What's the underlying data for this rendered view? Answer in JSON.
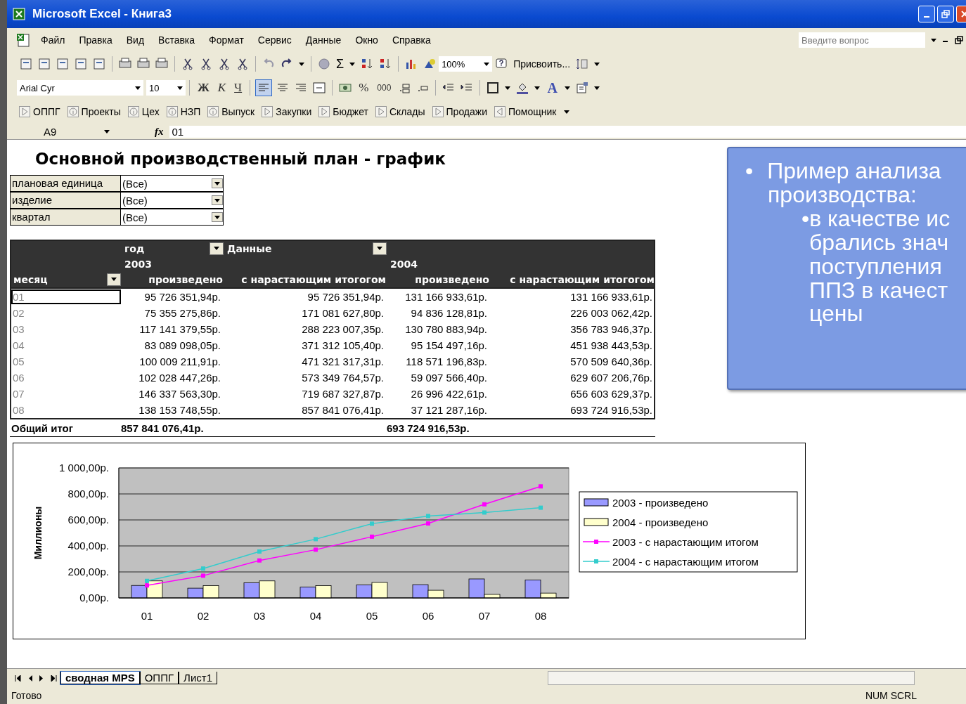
{
  "window": {
    "title": "Microsoft Excel - Книга3"
  },
  "menu": [
    "Файл",
    "Правка",
    "Вид",
    "Вставка",
    "Формат",
    "Сервис",
    "Данные",
    "Окно",
    "Справка"
  ],
  "help_search": {
    "placeholder": "Введите вопрос"
  },
  "standard_toolbar": {
    "sum": "Σ",
    "zoom": "100%",
    "assign": "Присвоить..."
  },
  "formatting_toolbar": {
    "font": "Arial Cyr",
    "size": "10",
    "bold": "Ж",
    "italic": "К",
    "underline": "Ч",
    "percent": "%",
    "thousands": "000",
    "font_color": "A"
  },
  "custom_toolbar": [
    {
      "label": "ОППГ",
      "kind": "play"
    },
    {
      "label": "Проекты",
      "kind": "info"
    },
    {
      "label": "Цех",
      "kind": "info"
    },
    {
      "label": "НЗП",
      "kind": "info"
    },
    {
      "label": "Выпуск",
      "kind": "info"
    },
    {
      "label": "Закупки",
      "kind": "play"
    },
    {
      "label": "Бюджет",
      "kind": "play"
    },
    {
      "label": "Склады",
      "kind": "play"
    },
    {
      "label": "Продажи",
      "kind": "play"
    },
    {
      "label": "Помощник",
      "kind": "back"
    }
  ],
  "formula_bar": {
    "cell": "A9",
    "fx": "fx",
    "value": "01"
  },
  "sheet": {
    "title": "Основной производственный план - график",
    "filters": [
      {
        "label": "плановая единица",
        "value": "(Все)"
      },
      {
        "label": "изделие",
        "value": "(Все)"
      },
      {
        "label": "квартал",
        "value": "(Все)"
      }
    ],
    "pivot": {
      "year_field": "год",
      "data_field": "Данные",
      "years": [
        "2003",
        "2004"
      ],
      "row_field": "месяц",
      "columns": [
        "произведено",
        "с нарастающим итогогом",
        "произведено",
        "с нарастающим итогогом"
      ],
      "rows": [
        {
          "month": "01",
          "selected": true,
          "cells": [
            "95 726 351,94р.",
            "95 726 351,94р.",
            "131 166 933,61р.",
            "131 166 933,61р."
          ]
        },
        {
          "month": "02",
          "selected": false,
          "cells": [
            "75 355 275,86р.",
            "171 081 627,80р.",
            "94 836 128,81р.",
            "226 003 062,42р."
          ]
        },
        {
          "month": "03",
          "selected": false,
          "cells": [
            "117 141 379,55р.",
            "288 223 007,35р.",
            "130 780 883,94р.",
            "356 783 946,37р."
          ]
        },
        {
          "month": "04",
          "selected": false,
          "cells": [
            "83 089 098,05р.",
            "371 312 105,40р.",
            "95 154 497,16р.",
            "451 938 443,53р."
          ]
        },
        {
          "month": "05",
          "selected": false,
          "cells": [
            "100 009 211,91р.",
            "471 321 317,31р.",
            "118 571 196,83р.",
            "570 509 640,36р."
          ]
        },
        {
          "month": "06",
          "selected": false,
          "cells": [
            "102 028 447,26р.",
            "573 349 764,57р.",
            "59 097 566,40р.",
            "629 607 206,76р."
          ]
        },
        {
          "month": "07",
          "selected": false,
          "cells": [
            "146 337 563,30р.",
            "719 687 327,87р.",
            "26 996 422,61р.",
            "656 603 629,37р."
          ]
        },
        {
          "month": "08",
          "selected": false,
          "cells": [
            "138 153 748,55р.",
            "857 841 076,41р.",
            "37 121 287,16р.",
            "693 724 916,53р."
          ]
        }
      ],
      "total": {
        "label": "Общий итог",
        "year_totals": [
          "857 841 076,41р.",
          "693 724 916,53р."
        ]
      }
    },
    "chart_data": {
      "type": "bar",
      "ylabel": "Миллионы",
      "grid": true,
      "legend": "right",
      "categories": [
        "01",
        "02",
        "03",
        "04",
        "05",
        "06",
        "07",
        "08"
      ],
      "ylim": [
        0,
        1000
      ],
      "yticks": [
        {
          "value": 0,
          "label": "0,00р."
        },
        {
          "value": 200,
          "label": "200,00р."
        },
        {
          "value": 400,
          "label": "400,00р."
        },
        {
          "value": 600,
          "label": "600,00р."
        },
        {
          "value": 800,
          "label": "800,00р."
        },
        {
          "value": 1000,
          "label": "1 000,00р."
        }
      ],
      "series": [
        {
          "name": "2003 - произведено",
          "color": "#9999ff",
          "values": [
            96,
            75,
            117,
            83,
            100,
            102,
            146,
            138
          ]
        },
        {
          "name": "2004 - произведено",
          "color": "#ffffcc",
          "values": [
            131,
            95,
            131,
            95,
            119,
            59,
            27,
            37
          ]
        },
        {
          "name": "2003 - с нарастающим итогом",
          "type": "line",
          "marker": "square",
          "color": "#ff00ff",
          "values": [
            96,
            171,
            288,
            371,
            471,
            573,
            720,
            858
          ]
        },
        {
          "name": "2004 - с нарастающим итогом",
          "type": "line",
          "marker": "square",
          "color": "#33cccc",
          "values": [
            131,
            226,
            357,
            452,
            571,
            630,
            657,
            694
          ]
        }
      ]
    }
  },
  "slide_callout": {
    "lines": [
      {
        "kind": "bullet",
        "bullet": "•",
        "text": "Пример анализа"
      },
      {
        "kind": "cont",
        "text": "производства:"
      },
      {
        "kind": "sub",
        "text": "•в качестве ис"
      },
      {
        "kind": "subcont",
        "text": "брались знач"
      },
      {
        "kind": "subcont",
        "text": "поступления"
      },
      {
        "kind": "subcont",
        "text": "ППЗ в качест"
      },
      {
        "kind": "subcont",
        "text": "цены"
      }
    ]
  },
  "sheet_tabs": [
    {
      "label": "сводная MPS",
      "selected": true
    },
    {
      "label": "ОППГ",
      "selected": false
    },
    {
      "label": "Лист1",
      "selected": false
    }
  ],
  "status_bar": {
    "text": "Готово",
    "indicators": "NUM SCRL"
  }
}
